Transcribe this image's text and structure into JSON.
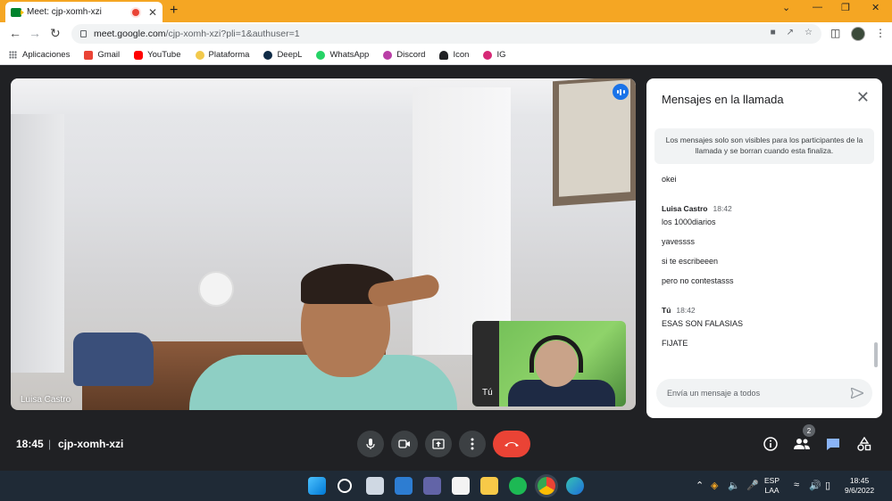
{
  "browser": {
    "tab_title": "Meet: cjp-xomh-xzi",
    "tab_close": "✕",
    "new_tab": "+",
    "url_host": "meet.google.com",
    "url_path": "/cjp-xomh-xzi?pli=1&authuser=1",
    "window_controls": {
      "minimize": "⌄",
      "min": "—",
      "max": "❐",
      "close": "✕"
    }
  },
  "bookmarks": [
    {
      "label": "Aplicaciones",
      "icon": "apps-grid-icon",
      "color": "#5f6368"
    },
    {
      "label": "Gmail",
      "icon": "gmail-icon",
      "color": "#ea4335"
    },
    {
      "label": "YouTube",
      "icon": "youtube-icon",
      "color": "#ff0000"
    },
    {
      "label": "Plataforma",
      "icon": "plataforma-icon",
      "color": "#f2c94c"
    },
    {
      "label": "DeepL",
      "icon": "deepl-icon",
      "color": "#0f2b46"
    },
    {
      "label": "WhatsApp",
      "icon": "whatsapp-icon",
      "color": "#25d366"
    },
    {
      "label": "Discord",
      "icon": "discord-icon",
      "color": "#b93ea6"
    },
    {
      "label": "Icon",
      "icon": "icon-bookmark-icon",
      "color": "#202124"
    },
    {
      "label": "IG",
      "icon": "instagram-icon",
      "color": "#d62976"
    }
  ],
  "meet": {
    "main_participant": "Luisa Castro",
    "self_label": "Tú",
    "clock": "18:45",
    "separator": "|",
    "meeting_code": "cjp-xomh-xzi",
    "participants_count": "2"
  },
  "chat": {
    "title": "Mensajes en la llamada",
    "notice": "Los mensajes solo son visibles para los participantes de la llamada y se borran cuando esta finaliza.",
    "input_placeholder": "Envía un mensaje a todos",
    "messages": [
      {
        "type": "text",
        "text": "okei"
      },
      {
        "type": "head",
        "sender": "Luisa Castro",
        "time": "18:42"
      },
      {
        "type": "text",
        "text": "los 1000diarios"
      },
      {
        "type": "text",
        "text": "yavessss"
      },
      {
        "type": "text",
        "text": "si te escribeeen"
      },
      {
        "type": "text",
        "text": "pero no contestasss"
      },
      {
        "type": "head",
        "sender": "Tú",
        "time": "18:42"
      },
      {
        "type": "text",
        "text": "ESAS SON FALASIAS"
      },
      {
        "type": "text",
        "text": "FIJATE"
      }
    ]
  },
  "taskbar": {
    "lang_top": "ESP",
    "lang_bottom": "LAA",
    "time": "18:45",
    "date": "9/6/2022"
  },
  "colors": {
    "tab_strip": "#f5a623",
    "meet_bg": "#202124",
    "hangup": "#ea4335",
    "accent": "#1a73e8"
  }
}
